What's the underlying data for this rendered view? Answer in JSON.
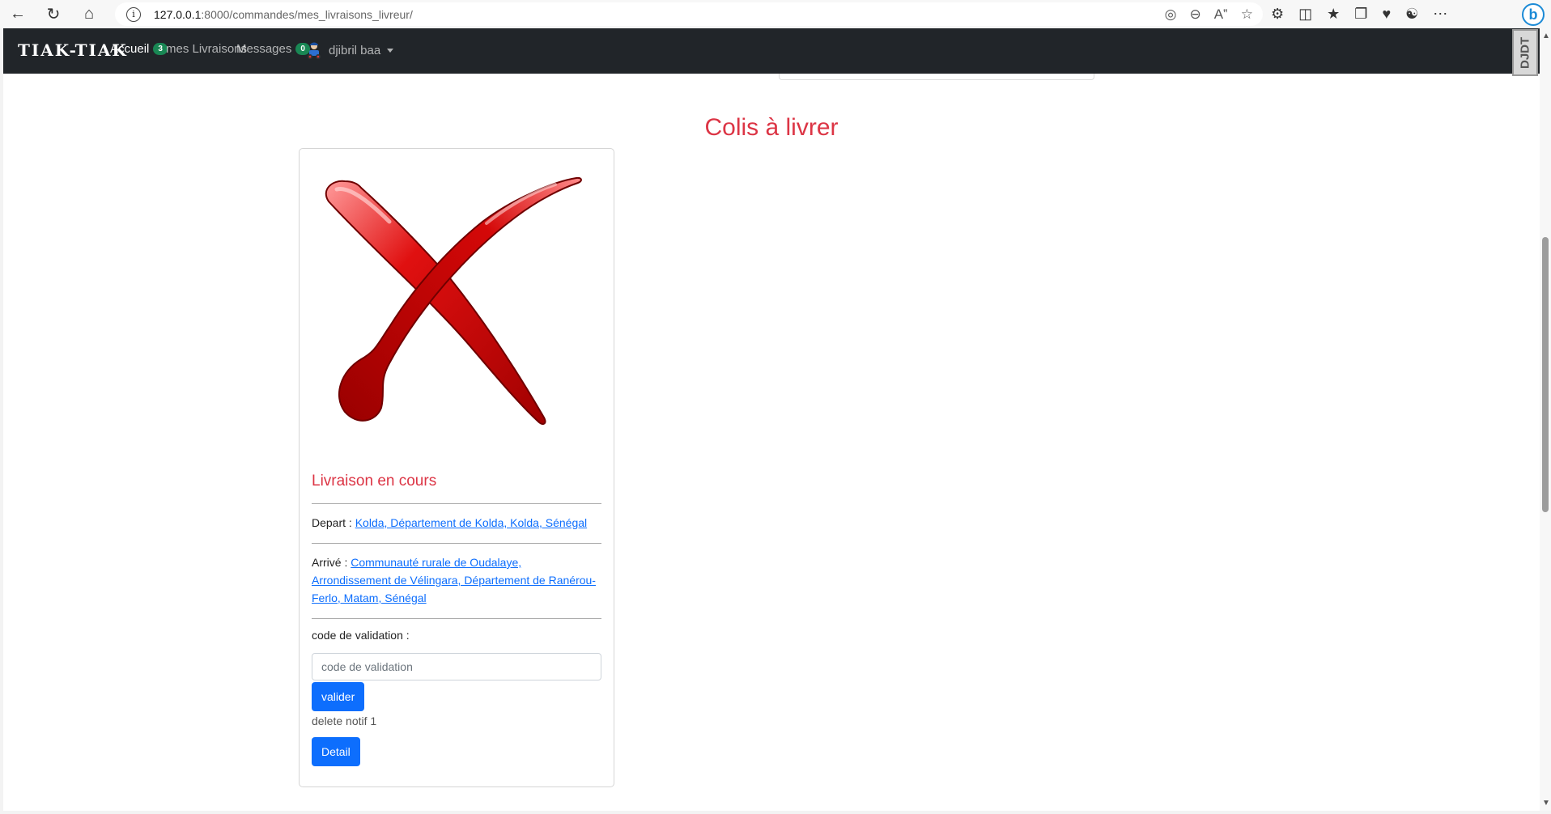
{
  "browser": {
    "url_host": "127.0.0.1",
    "url_path": ":8000/commandes/mes_livraisons_livreur/"
  },
  "navbar": {
    "brand": "TIAK-TIAK",
    "items": [
      {
        "label": "Accueil",
        "badge": "3"
      },
      {
        "label": "mes Livraisons"
      },
      {
        "label": "Messages",
        "badge": "0"
      }
    ],
    "user": "djibril baa"
  },
  "extension_tag": "DJDT",
  "page": {
    "title": "Colis à livrer"
  },
  "card": {
    "status": "Livraison en cours",
    "depart_label": "Depart :",
    "depart_value": "Kolda, Département de Kolda, Kolda, Sénégal",
    "arrive_label": "Arrivé :",
    "arrive_value": "Communauté rurale de Oudalaye, Arrondissement de Vélingara, Département de Ranérou-Ferlo, Matam, Sénégal",
    "code_label": "code de validation :",
    "code_placeholder": "code de validation",
    "validate_label": "valider",
    "notif_text": "delete notif 1",
    "detail_label": "Detail"
  },
  "colors": {
    "navbar_bg": "#212529",
    "accent_red": "#dc3545",
    "primary": "#0d6efd",
    "badge_green": "#198754"
  }
}
